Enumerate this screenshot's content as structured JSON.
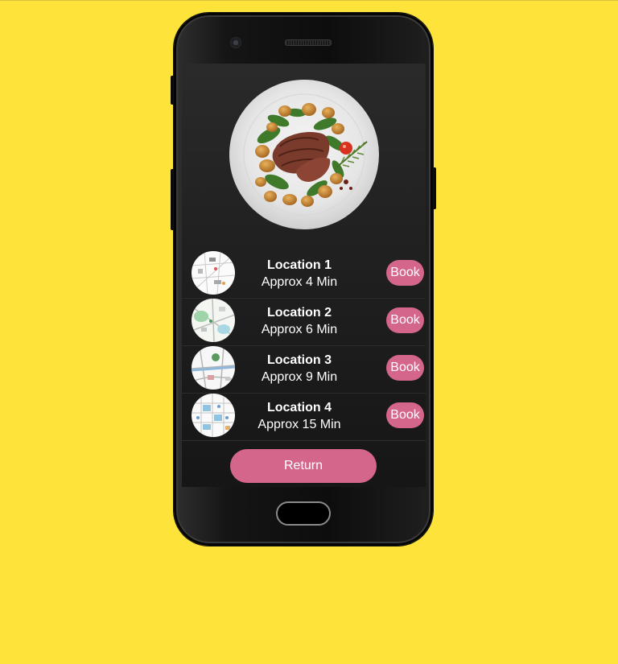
{
  "colors": {
    "background": "#fde33a",
    "accent": "#d4668c",
    "screen": "#1e1e1e",
    "text": "#ffffff"
  },
  "hero": {
    "image": "steak-salad-plate"
  },
  "locations": [
    {
      "name": "Location 1",
      "time": "Approx 4 Min",
      "book_label": "Book",
      "thumbnail": "map-thumbnail"
    },
    {
      "name": "Location 2",
      "time": "Approx 6 Min",
      "book_label": "Book",
      "thumbnail": "map-thumbnail"
    },
    {
      "name": "Location 3",
      "time": "Approx 9 Min",
      "book_label": "Book",
      "thumbnail": "map-thumbnail"
    },
    {
      "name": "Location 4",
      "time": "Approx 15 Min",
      "book_label": "Book",
      "thumbnail": "map-thumbnail"
    }
  ],
  "footer": {
    "return_label": "Return"
  }
}
